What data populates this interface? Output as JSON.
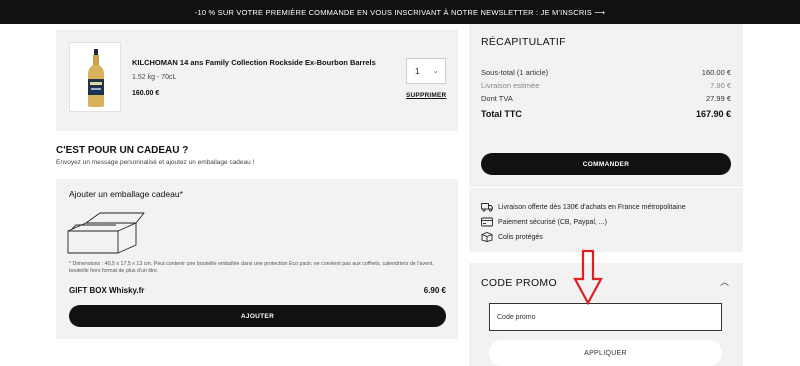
{
  "announcement": "-10 % SUR VOTRE PREMIÈRE COMMANDE EN VOUS INSCRIVANT À NOTRE NEWSLETTER : JE M'INSCRIS ⟶",
  "cart": {
    "item": {
      "title": "KILCHOMAN 14 ans Family Collection Rockside Ex-Bourbon Barrels",
      "meta": "1.52 kg - 70cL",
      "price": "160.00 €",
      "quantity": "1",
      "remove_label": "SUPPRIMER"
    }
  },
  "gift": {
    "title": "C'EST POUR UN CADEAU ?",
    "subtitle": "Envoyez un message personnalisé et ajoutez un emballage cadeau !",
    "option_label": "Ajouter un emballage cadeau*",
    "dimensions_note": "* Dimensions : 40,5 x 17,5 x 13 cm. Peut contenir une bouteille emballée dans une protection Eco pack; ne convient pas aux coffrets, calendriers de l'avent, bouteille hors format de plus d'un litre.",
    "product_name": "GIFT BOX Whisky.fr",
    "product_price": "6.90 €",
    "add_label": "AJOUTER"
  },
  "summary": {
    "title": "RÉCAPITULATIF",
    "subtotal_label": "Sous-total (1 article)",
    "subtotal_value": "160.00 €",
    "shipping_label": "Livraison estimée",
    "shipping_value": "7.90 €",
    "tax_label": "Dont TVA",
    "tax_value": "27.99 €",
    "total_label": "Total TTC",
    "total_value": "167.90 €",
    "order_label": "COMMANDER",
    "perks": [
      "Livraison offerte dès 130€ d'achats en France métropolitaine",
      "Paiement sécurisé (CB, Paypal, ...)",
      "Colis protégés"
    ]
  },
  "promo": {
    "title": "CODE PROMO",
    "placeholder": "Code promo",
    "apply_label": "APPLIQUER"
  },
  "colors": {
    "dark": "#111111",
    "panel": "#f2f2f2",
    "annotation_arrow": "#e02020"
  }
}
